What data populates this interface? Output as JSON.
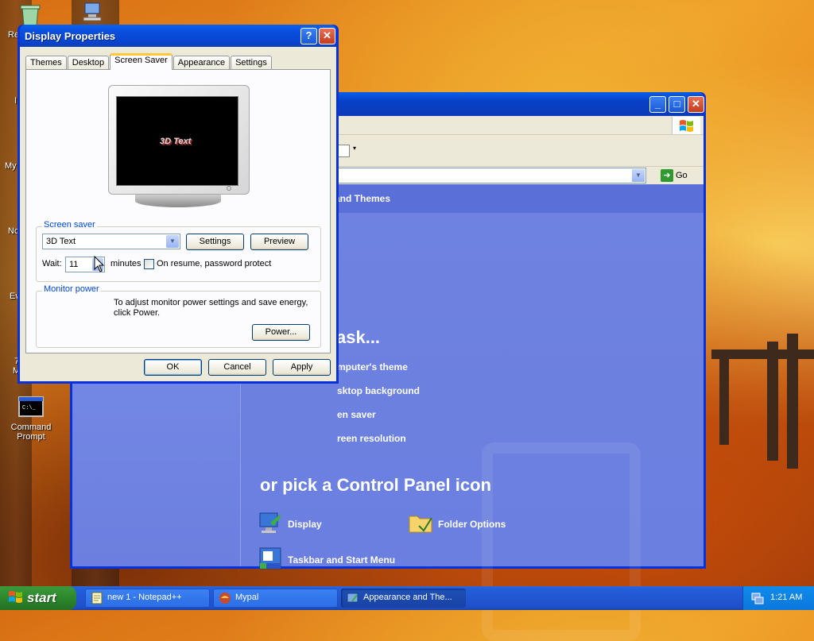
{
  "desktop": {
    "icons": [
      {
        "label": "Command Prompt",
        "icon": "command-prompt-icon"
      }
    ],
    "cut_labels": [
      "Re",
      "I",
      "My",
      "Nc",
      "Ev",
      "7",
      "M"
    ]
  },
  "control_panel": {
    "banner": "and Themes",
    "pick_task": "ask...",
    "tasks": [
      "mputer's theme",
      "sktop background",
      "en saver",
      "reen resolution"
    ],
    "pick_icon": "or pick a Control Panel icon",
    "icons": [
      {
        "label": "Display",
        "icon": "display-icon"
      },
      {
        "label": "Folder Options",
        "icon": "folder-options-icon"
      },
      {
        "label": "Taskbar and Start Menu",
        "icon": "taskbar-start-menu-icon"
      }
    ],
    "go_label": "Go"
  },
  "dialog": {
    "title": "Display Properties",
    "tabs": [
      "Themes",
      "Desktop",
      "Screen Saver",
      "Appearance",
      "Settings"
    ],
    "active_tab": "Screen Saver",
    "preview_text": "3D Text",
    "screen_saver": {
      "group_label": "Screen saver",
      "selected": "3D Text",
      "settings_button": "Settings",
      "preview_button": "Preview",
      "wait_label": "Wait:",
      "wait_value": "11",
      "minutes_label": "minutes",
      "password_label": "On resume, password protect",
      "password_checked": false
    },
    "monitor_power": {
      "group_label": "Monitor power",
      "description_line1": "To adjust monitor power settings and save energy,",
      "description_line2": "click Power.",
      "power_button": "Power..."
    },
    "ok_button": "OK",
    "cancel_button": "Cancel",
    "apply_button": "Apply"
  },
  "taskbar": {
    "start_label": "start",
    "tasks": [
      {
        "label": "new 1 - Notepad++",
        "icon": "notepad-plus-plus-icon"
      },
      {
        "label": "Mypal",
        "icon": "mypal-browser-icon"
      },
      {
        "label": "Appearance and The...",
        "icon": "control-panel-icon"
      }
    ],
    "clock": "1:21 AM"
  },
  "colors": {
    "xp_blue": "#0831d9",
    "dialog_face": "#ece9d8",
    "cp_content": "#6f82e2",
    "start_green": "#2e8b2e",
    "group_label": "#0046d5"
  }
}
